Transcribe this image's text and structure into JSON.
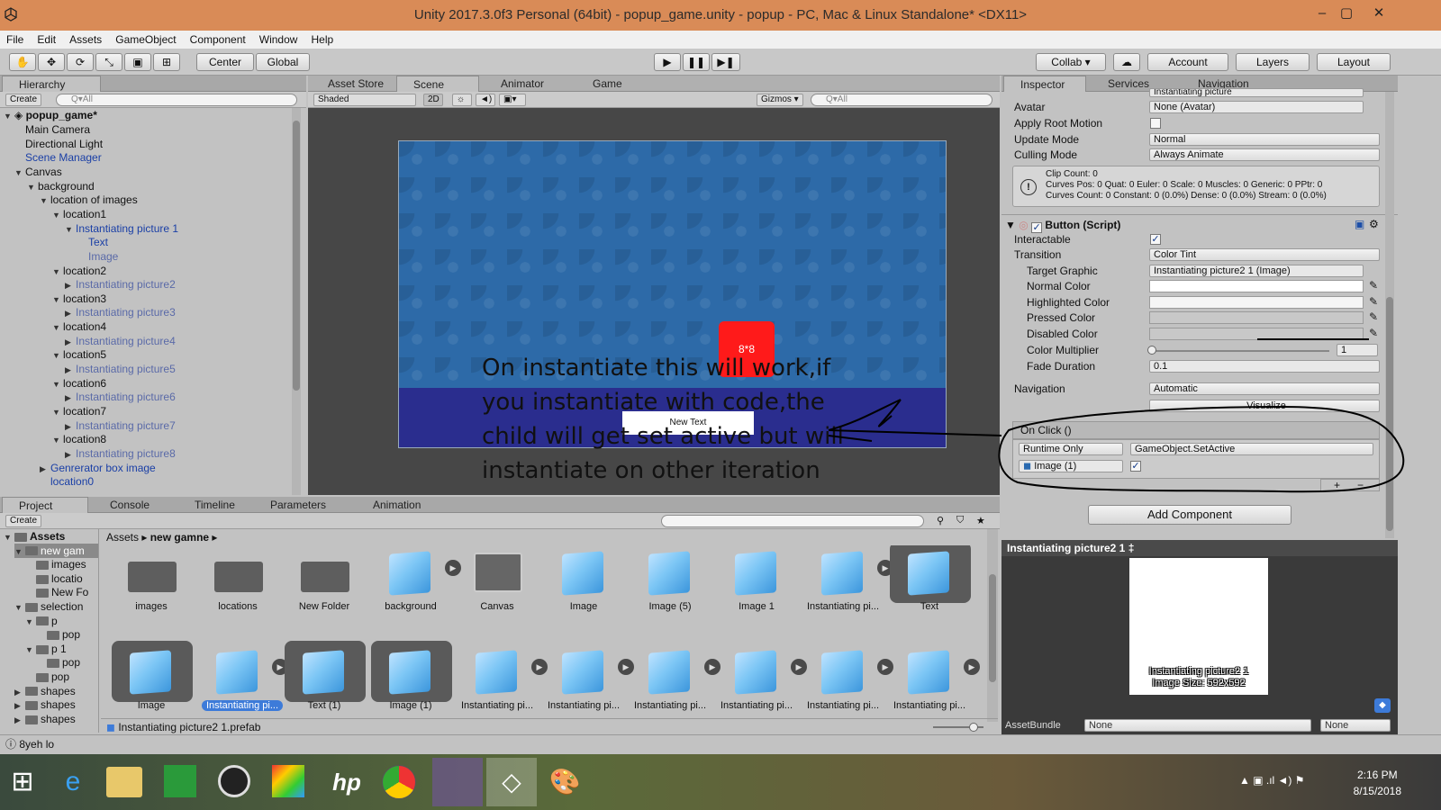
{
  "window": {
    "title": "Unity 2017.3.0f3 Personal (64bit) - popup_game.unity - popup - PC, Mac & Linux Standalone* <DX11>",
    "controls": [
      "–",
      "▢",
      "✕"
    ]
  },
  "menu": [
    "File",
    "Edit",
    "Assets",
    "GameObject",
    "Component",
    "Window",
    "Help"
  ],
  "toolbar": {
    "pivot": "Center",
    "space": "Global",
    "collab": "Collab ▾",
    "account": "Account",
    "layers": "Layers",
    "layout": "Layout"
  },
  "hierarchy": {
    "tab": "Hierarchy",
    "create": "Create",
    "search_placeholder": "Q▾All",
    "scene_name": "popup_game*",
    "rows": [
      {
        "label": "Main Camera",
        "indent": 0,
        "arrow": "",
        "style": "normal"
      },
      {
        "label": "Directional Light",
        "indent": 0,
        "arrow": "",
        "style": "normal"
      },
      {
        "label": "Scene Manager",
        "indent": 0,
        "arrow": "",
        "style": "blue"
      },
      {
        "label": "Canvas",
        "indent": 0,
        "arrow": "▼",
        "style": "normal"
      },
      {
        "label": "background",
        "indent": 1,
        "arrow": "▼",
        "style": "normal"
      },
      {
        "label": "location of images",
        "indent": 2,
        "arrow": "▼",
        "style": "normal"
      },
      {
        "label": "location1",
        "indent": 3,
        "arrow": "▼",
        "style": "normal"
      },
      {
        "label": "Instantiating picture 1",
        "indent": 4,
        "arrow": "▼",
        "style": "blue"
      },
      {
        "label": "Text",
        "indent": 5,
        "arrow": "",
        "style": "blue"
      },
      {
        "label": "Image",
        "indent": 5,
        "arrow": "",
        "style": "gray"
      },
      {
        "label": "location2",
        "indent": 3,
        "arrow": "▼",
        "style": "normal"
      },
      {
        "label": "Instantiating picture2",
        "indent": 4,
        "arrow": "▶",
        "style": "gray"
      },
      {
        "label": "location3",
        "indent": 3,
        "arrow": "▼",
        "style": "normal"
      },
      {
        "label": "Instantiating picture3",
        "indent": 4,
        "arrow": "▶",
        "style": "gray"
      },
      {
        "label": "location4",
        "indent": 3,
        "arrow": "▼",
        "style": "normal"
      },
      {
        "label": "Instantiating picture4",
        "indent": 4,
        "arrow": "▶",
        "style": "gray"
      },
      {
        "label": "location5",
        "indent": 3,
        "arrow": "▼",
        "style": "normal"
      },
      {
        "label": "Instantiating picture5",
        "indent": 4,
        "arrow": "▶",
        "style": "gray"
      },
      {
        "label": "location6",
        "indent": 3,
        "arrow": "▼",
        "style": "normal"
      },
      {
        "label": "Instantiating picture6",
        "indent": 4,
        "arrow": "▶",
        "style": "gray"
      },
      {
        "label": "location7",
        "indent": 3,
        "arrow": "▼",
        "style": "normal"
      },
      {
        "label": "Instantiating picture7",
        "indent": 4,
        "arrow": "▶",
        "style": "gray"
      },
      {
        "label": "location8",
        "indent": 3,
        "arrow": "▼",
        "style": "normal"
      },
      {
        "label": "Instantiating picture8",
        "indent": 4,
        "arrow": "▶",
        "style": "gray"
      },
      {
        "label": "Genrerator box image",
        "indent": 2,
        "arrow": "▶",
        "style": "blue"
      },
      {
        "label": "location0",
        "indent": 2,
        "arrow": "",
        "style": "blue"
      }
    ]
  },
  "scene": {
    "tabs": [
      "Asset Store",
      "Scene",
      "Animator",
      "Game"
    ],
    "shading": "Shaded",
    "mode2d": "2D",
    "gizmos": "Gizmos ▾",
    "search_placeholder": "Q▾All",
    "red_button_text": "8*8",
    "new_text": "New Text",
    "annotation": "On instantiate this will work,if you instantiate with code,the child will get set active but will instantiate on other iteration"
  },
  "inspector": {
    "tabs": [
      "Inspector",
      "Services",
      "Navigation"
    ],
    "controller_value": "Instantiating picture",
    "avatar_label": "Avatar",
    "avatar_value": "None (Avatar)",
    "apply_root_motion": "Apply Root Motion",
    "update_mode_label": "Update Mode",
    "update_mode_value": "Normal",
    "culling_mode_label": "Culling Mode",
    "culling_mode_value": "Always Animate",
    "info_lines": [
      "Clip Count: 0",
      "Curves Pos: 0 Quat: 0 Euler: 0 Scale: 0 Muscles: 0 Generic: 0 PPtr: 0",
      "Curves Count: 0 Constant: 0 (0.0%) Dense: 0 (0.0%) Stream: 0 (0.0%)"
    ],
    "component_title": "Button (Script)",
    "interactable_label": "Interactable",
    "transition_label": "Transition",
    "transition_value": "Color Tint",
    "target_graphic_label": "Target Graphic",
    "target_graphic_value": "Instantiating picture2 1 (Image)",
    "normal_color_label": "Normal Color",
    "highlighted_color_label": "Highlighted Color",
    "pressed_color_label": "Pressed Color",
    "disabled_color_label": "Disabled Color",
    "color_multiplier_label": "Color Multiplier",
    "color_multiplier_value": "1",
    "fade_duration_label": "Fade Duration",
    "fade_duration_value": "0.1",
    "navigation_label": "Navigation",
    "navigation_value": "Automatic",
    "visualize": "Visualize",
    "onclick_title": "On Click ()",
    "runtime": "Runtime Only",
    "function": "GameObject.SetActive",
    "target_object": "Image (1)",
    "add_component": "Add Component",
    "plus": "+",
    "minus": "−"
  },
  "preview": {
    "header": "Instantiating picture2 1 ‡",
    "caption_line1": "Instantiating picture2 1",
    "caption_line2": "Image Size: 592x592",
    "assetbundle_label": "AssetBundle",
    "assetbundle_value": "None",
    "variant_value": "None"
  },
  "project": {
    "tabs": [
      "Project",
      "Console",
      "Timeline",
      "Parameters",
      "Animation"
    ],
    "create": "Create",
    "breadcrumb_root": "Assets",
    "breadcrumb_folder": "new gamne",
    "tree": [
      {
        "label": "Assets",
        "indent": 0,
        "arrow": "▼",
        "bold": true
      },
      {
        "label": "new gam",
        "indent": 1,
        "arrow": "▼",
        "bold": false
      },
      {
        "label": "images",
        "indent": 2,
        "arrow": "",
        "bold": false
      },
      {
        "label": "locatio",
        "indent": 2,
        "arrow": "",
        "bold": false
      },
      {
        "label": "New Fo",
        "indent": 2,
        "arrow": "",
        "bold": false
      },
      {
        "label": "selection",
        "indent": 1,
        "arrow": "▼",
        "bold": false
      },
      {
        "label": "p",
        "indent": 2,
        "arrow": "▼",
        "bold": false
      },
      {
        "label": "pop",
        "indent": 3,
        "arrow": "",
        "bold": false
      },
      {
        "label": "p 1",
        "indent": 2,
        "arrow": "▼",
        "bold": false
      },
      {
        "label": "pop",
        "indent": 3,
        "arrow": "",
        "bold": false
      },
      {
        "label": "pop",
        "indent": 2,
        "arrow": "",
        "bold": false
      },
      {
        "label": "shapes",
        "indent": 1,
        "arrow": "▶",
        "bold": false
      },
      {
        "label": "shapes",
        "indent": 1,
        "arrow": "▶",
        "bold": false
      },
      {
        "label": "shapes",
        "indent": 1,
        "arrow": "▶",
        "bold": false
      }
    ],
    "row1": [
      {
        "label": "images",
        "kind": "folder"
      },
      {
        "label": "locations",
        "kind": "folder"
      },
      {
        "label": "New Folder",
        "kind": "folder"
      },
      {
        "label": "background",
        "kind": "cube"
      },
      {
        "label": "Canvas",
        "kind": "canvas"
      },
      {
        "label": "Image",
        "kind": "cube"
      },
      {
        "label": "Image (5)",
        "kind": "cube"
      },
      {
        "label": "Image 1",
        "kind": "cube"
      },
      {
        "label": "Instantiating pi...",
        "kind": "cube"
      },
      {
        "label": "Text",
        "kind": "cube"
      }
    ],
    "row2": [
      {
        "label": "Image",
        "kind": "cube"
      },
      {
        "label": "Instantiating pi...",
        "kind": "cube"
      },
      {
        "label": "Text (1)",
        "kind": "cube"
      },
      {
        "label": "Image (1)",
        "kind": "cube"
      },
      {
        "label": "Instantiating pi...",
        "kind": "cube"
      },
      {
        "label": "Instantiating pi...",
        "kind": "cube"
      },
      {
        "label": "Instantiating pi...",
        "kind": "cube"
      },
      {
        "label": "Instantiating pi...",
        "kind": "cube"
      },
      {
        "label": "Instantiating pi...",
        "kind": "cube"
      },
      {
        "label": "Instantiating pi...",
        "kind": "cube"
      }
    ],
    "selected_file": "Instantiating picture2 1.prefab"
  },
  "status": {
    "text": "8yeh lo"
  },
  "taskbar": {
    "time": "2:16 PM",
    "date": "8/15/2018"
  },
  "colors": {
    "titlebar": "#d98b57",
    "scene_bg": "#474747",
    "canvas_blue": "#2d6aa8",
    "band": "#2a2d8e",
    "red_button": "#ff1a1a",
    "selection": "#3d7bd9"
  }
}
